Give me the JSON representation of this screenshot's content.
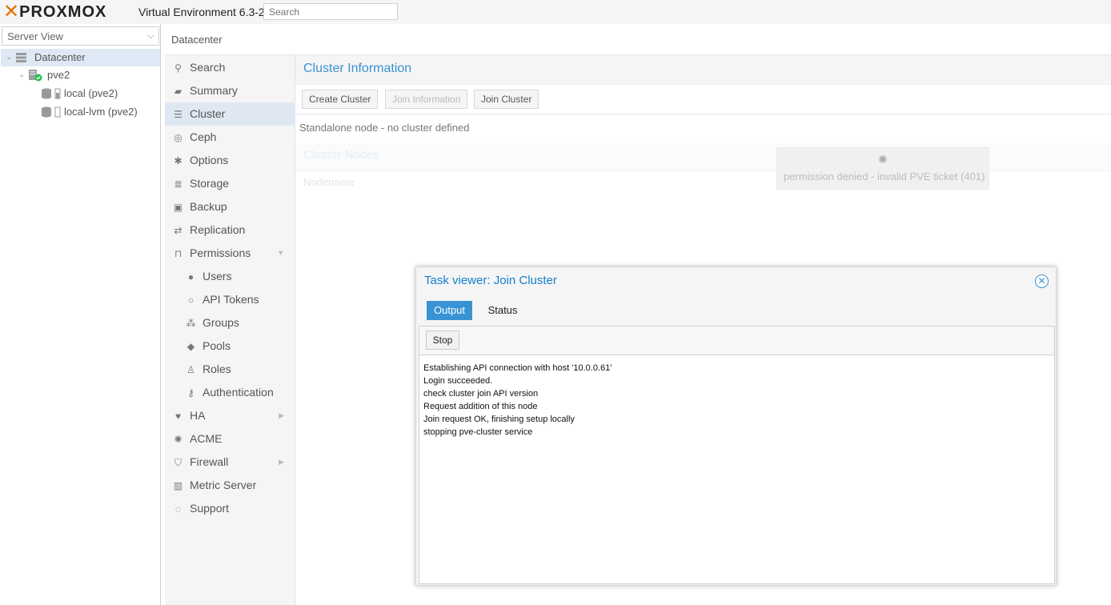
{
  "header": {
    "logo_text": "PROXMOX",
    "version": "Virtual Environment 6.3-2",
    "search_placeholder": "Search"
  },
  "tree": {
    "view": "Server View",
    "items": [
      {
        "label": "Datacenter",
        "icon": "datacenter-icon"
      },
      {
        "label": "pve2",
        "icon": "node-online-icon"
      },
      {
        "label": "local (pve2)",
        "icon": "storage-icon"
      },
      {
        "label": "local-lvm (pve2)",
        "icon": "storage-icon"
      }
    ]
  },
  "breadcrumb": "Datacenter",
  "nav": {
    "items": [
      {
        "label": "Search",
        "icon": "search-icon"
      },
      {
        "label": "Summary",
        "icon": "book-icon"
      },
      {
        "label": "Cluster",
        "icon": "server-icon"
      },
      {
        "label": "Ceph",
        "icon": "ceph-icon"
      },
      {
        "label": "Options",
        "icon": "gear-icon"
      },
      {
        "label": "Storage",
        "icon": "database-icon"
      },
      {
        "label": "Backup",
        "icon": "floppy-icon"
      },
      {
        "label": "Replication",
        "icon": "retweet-icon"
      },
      {
        "label": "Permissions",
        "icon": "unlock-icon"
      },
      {
        "label": "Users",
        "icon": "user-icon"
      },
      {
        "label": "API Tokens",
        "icon": "user-outline-icon"
      },
      {
        "label": "Groups",
        "icon": "users-icon"
      },
      {
        "label": "Pools",
        "icon": "tags-icon"
      },
      {
        "label": "Roles",
        "icon": "male-icon"
      },
      {
        "label": "Authentication",
        "icon": "key-icon"
      },
      {
        "label": "HA",
        "icon": "heartbeat-icon"
      },
      {
        "label": "ACME",
        "icon": "certificate-icon"
      },
      {
        "label": "Firewall",
        "icon": "shield-icon"
      },
      {
        "label": "Metric Server",
        "icon": "bar-chart-icon"
      },
      {
        "label": "Support",
        "icon": "comments-icon"
      }
    ]
  },
  "cluster": {
    "info_title": "Cluster Information",
    "buttons": {
      "create": "Create Cluster",
      "join_info": "Join Information",
      "join": "Join Cluster"
    },
    "standalone_text": "Standalone node - no cluster defined",
    "nodes_title": "Cluster Nodes",
    "nodes_column": "Nodename",
    "loading_message": "permission denied - invalid PVE ticket (401)"
  },
  "taskviewer": {
    "title": "Task viewer: Join Cluster",
    "tabs": {
      "output": "Output",
      "status": "Status"
    },
    "stop_label": "Stop",
    "log": [
      "Establishing API connection with host '10.0.0.61'",
      "Login succeeded.",
      "check cluster join API version",
      "Request addition of this node",
      "Join request OK, finishing setup locally",
      "stopping pve-cluster service"
    ]
  },
  "colors": {
    "accent": "#3892d3",
    "brand": "#e57000",
    "selection": "#dfe9f5"
  }
}
